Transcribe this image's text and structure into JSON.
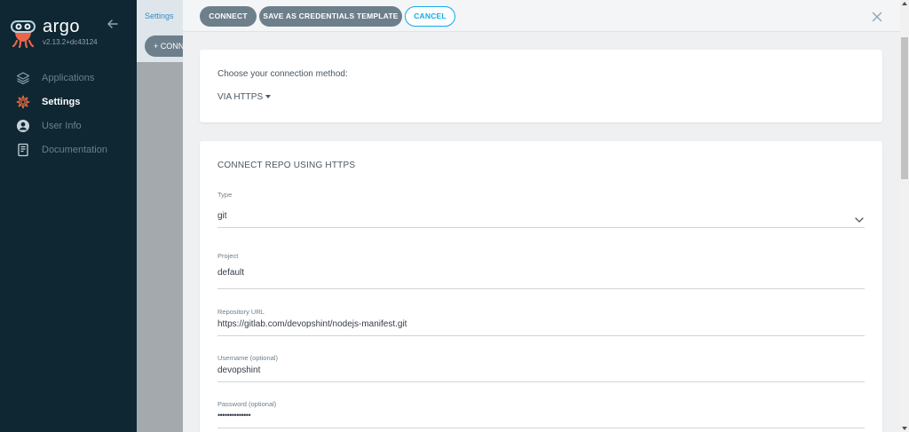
{
  "app": {
    "name": "argo",
    "version": "v2.13.2+dc43124"
  },
  "sidebar": {
    "items": [
      {
        "label": "Applications",
        "icon": "layers-icon",
        "active": false
      },
      {
        "label": "Settings",
        "icon": "gear-icon",
        "active": true
      },
      {
        "label": "User Info",
        "icon": "user-circle-icon",
        "active": false
      },
      {
        "label": "Documentation",
        "icon": "book-icon",
        "active": false
      }
    ]
  },
  "background": {
    "breadcrumb": "Settings",
    "connect_button": "+ CONN"
  },
  "toolbar": {
    "connect": "CONNECT",
    "save_template": "SAVE AS CREDENTIALS TEMPLATE",
    "cancel": "CANCEL"
  },
  "method_card": {
    "label": "Choose your connection method:",
    "selected": "VIA HTTPS"
  },
  "form": {
    "title": "CONNECT REPO USING HTTPS",
    "type": {
      "label": "Type",
      "value": "git"
    },
    "project": {
      "label": "Project",
      "value": "default"
    },
    "repo_url": {
      "label": "Repository URL",
      "value": "https://gitlab.com/devopshint/nodejs-manifest.git"
    },
    "username": {
      "label": "Username (optional)",
      "value": "devopshint"
    },
    "password": {
      "label": "Password (optional)",
      "value": "••••••••••••••"
    }
  },
  "colors": {
    "sidebar_bg": "#0f2733",
    "accent": "#0dadea",
    "button_dark": "#6d7f8b",
    "settings_icon": "#e96d3f"
  }
}
